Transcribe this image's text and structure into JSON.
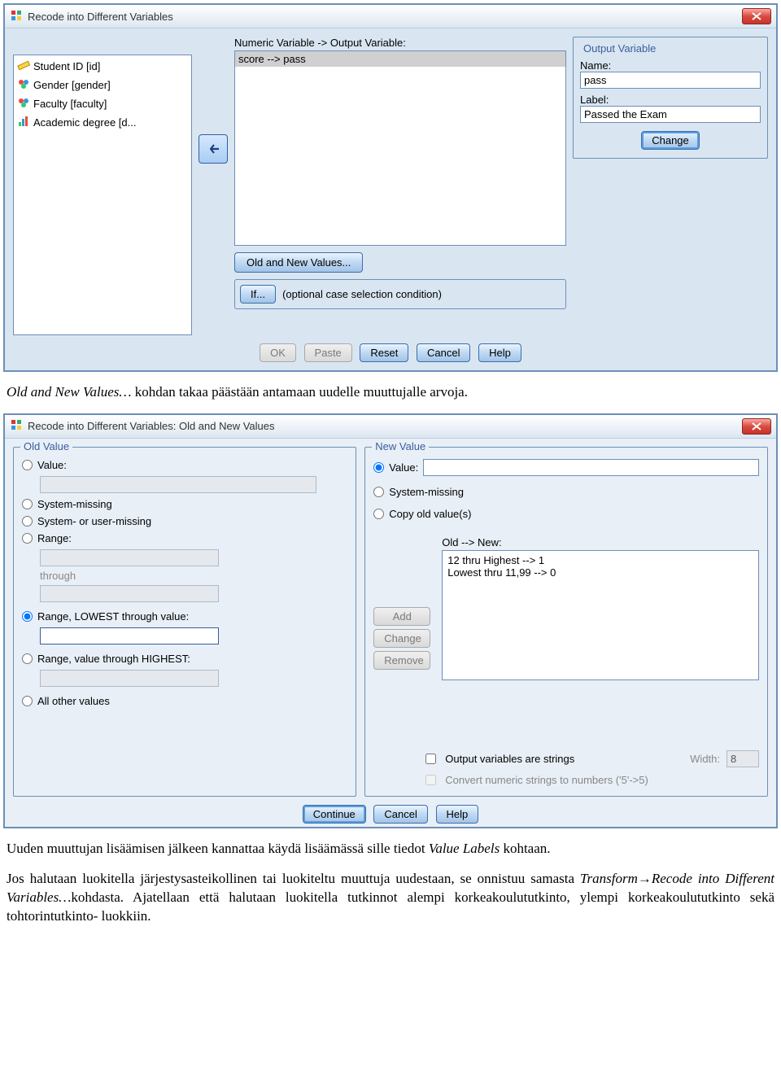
{
  "dialog1": {
    "title": "Recode into Different Variables",
    "variables": [
      {
        "label": "Student ID [id]",
        "icon": "ruler"
      },
      {
        "label": "Gender [gender]",
        "icon": "nominal"
      },
      {
        "label": "Faculty [faculty]",
        "icon": "nominal"
      },
      {
        "label": "Academic degree [d...",
        "icon": "ordinal"
      }
    ],
    "center_label": "Numeric Variable -> Output Variable:",
    "mapping_selected": "score --> pass",
    "output_variable": {
      "legend": "Output Variable",
      "name_label": "Name:",
      "name_value": "pass",
      "label_label": "Label:",
      "label_value": "Passed the Exam",
      "change": "Change"
    },
    "old_new_btn": "Old and New Values...",
    "if_btn": "If...",
    "if_text": "(optional case selection condition)",
    "buttons": {
      "ok": "OK",
      "paste": "Paste",
      "reset": "Reset",
      "cancel": "Cancel",
      "help": "Help"
    }
  },
  "mid_text": "Old and New Values… kohdan takaa päästään antamaan uudelle muuttujalle arvoja.",
  "dialog2": {
    "title": "Recode into Different Variables: Old and New Values",
    "old_legend": "Old Value",
    "new_legend": "New Value",
    "old": {
      "value": "Value:",
      "sysmissing": "System-missing",
      "sysusermissing": "System- or user-missing",
      "range": "Range:",
      "through": "through",
      "range_low": "Range, LOWEST through value:",
      "range_high": "Range, value through HIGHEST:",
      "allother": "All other values"
    },
    "new": {
      "value": "Value:",
      "sysmissing": "System-missing",
      "copy": "Copy old value(s)",
      "oldnew_label": "Old --> New:",
      "items": [
        "12 thru Highest --> 1",
        "Lowest thru 11,99 --> 0"
      ],
      "output_strings": "Output variables are strings",
      "width_label": "Width:",
      "width_value": "8",
      "convert": "Convert numeric strings to numbers ('5'->5)"
    },
    "mid_buttons": {
      "add": "Add",
      "change": "Change",
      "remove": "Remove"
    },
    "buttons": {
      "continue": "Continue",
      "cancel": "Cancel",
      "help": "Help"
    }
  },
  "bottom_text1": "Uuden muuttujan lisäämisen jälkeen kannattaa käydä lisäämässä sille tiedot Value Labels kohtaan.",
  "bottom_text1_em": "Value Labels",
  "bottom_text2_pre": "Jos halutaan luokitella järjestysasteikollinen tai luokiteltu muuttuja uudestaan, se onnistuu samasta ",
  "bottom_text2_em": "Transform→Recode into Different Variables…",
  "bottom_text2_post": "kohdasta. Ajatellaan että halutaan luokitella tutkinnot alempi korkeakoulututkinto, ylempi korkeakoulututkinto sekä tohtorintutkinto- luokkiin."
}
